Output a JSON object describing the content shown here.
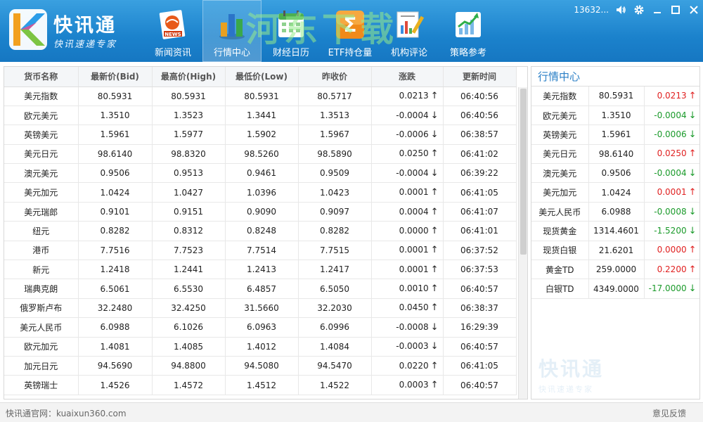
{
  "app": {
    "name": "快讯通",
    "slogan": "快讯速递专家",
    "username": "13632...",
    "watermark_text": "河东下载",
    "watermark_url": "www.pc0359.cn"
  },
  "nav": [
    {
      "label": "新闻资讯",
      "icon": "news-icon",
      "active": false
    },
    {
      "label": "行情中心",
      "icon": "bar-chart-icon",
      "active": true
    },
    {
      "label": "财经日历",
      "icon": "calendar-icon",
      "active": false
    },
    {
      "label": "ETF持仓量",
      "icon": "sigma-icon",
      "active": false
    },
    {
      "label": "机构评论",
      "icon": "report-icon",
      "active": false
    },
    {
      "label": "策略参考",
      "icon": "trend-chart-icon",
      "active": false
    }
  ],
  "colors": {
    "up": "#e02020",
    "down": "#1a9a2a",
    "header_blue": "#1b82cc",
    "side_title": "#2a7fc6"
  },
  "table": {
    "headers": [
      "货币名称",
      "最新价(Bid)",
      "最高价(High)",
      "最低价(Low)",
      "昨收价",
      "涨跌",
      "更新时间"
    ],
    "rows": [
      {
        "name": "美元指数",
        "bid": "80.5931",
        "high": "80.5931",
        "low": "80.5931",
        "prev": "80.5717",
        "change": "0.0213",
        "dir": "up",
        "time": "06:40:56"
      },
      {
        "name": "欧元美元",
        "bid": "1.3510",
        "high": "1.3523",
        "low": "1.3441",
        "prev": "1.3513",
        "change": "-0.0004",
        "dir": "down",
        "time": "06:40:56"
      },
      {
        "name": "英镑美元",
        "bid": "1.5961",
        "high": "1.5977",
        "low": "1.5902",
        "prev": "1.5967",
        "change": "-0.0006",
        "dir": "down",
        "time": "06:38:57"
      },
      {
        "name": "美元日元",
        "bid": "98.6140",
        "high": "98.8320",
        "low": "98.5260",
        "prev": "98.5890",
        "change": "0.0250",
        "dir": "up",
        "time": "06:41:02"
      },
      {
        "name": "澳元美元",
        "bid": "0.9506",
        "high": "0.9513",
        "low": "0.9461",
        "prev": "0.9509",
        "change": "-0.0004",
        "dir": "down",
        "time": "06:39:22"
      },
      {
        "name": "美元加元",
        "bid": "1.0424",
        "high": "1.0427",
        "low": "1.0396",
        "prev": "1.0423",
        "change": "0.0001",
        "dir": "up",
        "time": "06:41:05"
      },
      {
        "name": "美元瑞郎",
        "bid": "0.9101",
        "high": "0.9151",
        "low": "0.9090",
        "prev": "0.9097",
        "change": "0.0004",
        "dir": "up",
        "time": "06:41:07"
      },
      {
        "name": "纽元",
        "bid": "0.8282",
        "high": "0.8312",
        "low": "0.8248",
        "prev": "0.8282",
        "change": "0.0000",
        "dir": "up",
        "time": "06:41:01"
      },
      {
        "name": "港币",
        "bid": "7.7516",
        "high": "7.7523",
        "low": "7.7514",
        "prev": "7.7515",
        "change": "0.0001",
        "dir": "up",
        "time": "06:37:52"
      },
      {
        "name": "新元",
        "bid": "1.2418",
        "high": "1.2441",
        "low": "1.2413",
        "prev": "1.2417",
        "change": "0.0001",
        "dir": "up",
        "time": "06:37:53"
      },
      {
        "name": "瑞典克朗",
        "bid": "6.5061",
        "high": "6.5530",
        "low": "6.4857",
        "prev": "6.5050",
        "change": "0.0010",
        "dir": "up",
        "time": "06:40:57"
      },
      {
        "name": "俄罗斯卢布",
        "bid": "32.2480",
        "high": "32.4250",
        "low": "31.5660",
        "prev": "32.2030",
        "change": "0.0450",
        "dir": "up",
        "time": "06:38:37"
      },
      {
        "name": "美元人民币",
        "bid": "6.0988",
        "high": "6.1026",
        "low": "6.0963",
        "prev": "6.0996",
        "change": "-0.0008",
        "dir": "down",
        "time": "16:29:39"
      },
      {
        "name": "欧元加元",
        "bid": "1.4081",
        "high": "1.4085",
        "low": "1.4012",
        "prev": "1.4084",
        "change": "-0.0003",
        "dir": "down",
        "time": "06:40:57"
      },
      {
        "name": "加元日元",
        "bid": "94.5690",
        "high": "94.8800",
        "low": "94.5080",
        "prev": "94.5470",
        "change": "0.0220",
        "dir": "up",
        "time": "06:41:05"
      },
      {
        "name": "英镑瑞士",
        "bid": "1.4526",
        "high": "1.4572",
        "low": "1.4512",
        "prev": "1.4522",
        "change": "0.0003",
        "dir": "up",
        "time": "06:40:57"
      }
    ]
  },
  "side": {
    "title": "行情中心",
    "rows": [
      {
        "name": "美元指数",
        "price": "80.5931",
        "change": "0.0213",
        "dir": "up"
      },
      {
        "name": "欧元美元",
        "price": "1.3510",
        "change": "-0.0004",
        "dir": "down"
      },
      {
        "name": "英镑美元",
        "price": "1.5961",
        "change": "-0.0006",
        "dir": "down"
      },
      {
        "name": "美元日元",
        "price": "98.6140",
        "change": "0.0250",
        "dir": "up"
      },
      {
        "name": "澳元美元",
        "price": "0.9506",
        "change": "-0.0004",
        "dir": "down"
      },
      {
        "name": "美元加元",
        "price": "1.0424",
        "change": "0.0001",
        "dir": "up"
      },
      {
        "name": "美元人民币",
        "price": "6.0988",
        "change": "-0.0008",
        "dir": "down"
      },
      {
        "name": "现货黄金",
        "price": "1314.4601",
        "change": "-1.5200",
        "dir": "down"
      },
      {
        "name": "现货白银",
        "price": "21.6201",
        "change": "0.0000",
        "dir": "up"
      },
      {
        "name": "黄金TD",
        "price": "259.0000",
        "change": "0.2200",
        "dir": "up"
      },
      {
        "name": "白银TD",
        "price": "4349.0000",
        "change": "-17.0000",
        "dir": "down"
      }
    ],
    "logo_text": "快讯通",
    "logo_slogan": "快讯速递专家"
  },
  "status": {
    "left": "快讯通官网：kuaixun360.com",
    "right": "意见反馈"
  }
}
